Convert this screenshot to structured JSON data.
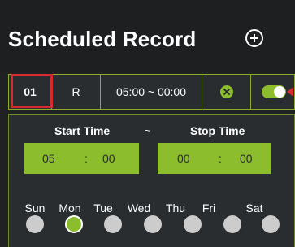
{
  "header": {
    "title": "Scheduled Record",
    "add_icon": "plus-circle-icon"
  },
  "schedule": {
    "id": "01",
    "mode": "R",
    "time_range": "05:00 ~ 00:00",
    "delete_icon": "close-circle-icon",
    "enabled": true
  },
  "detail": {
    "start_label": "Start Time",
    "separator": "~",
    "stop_label": "Stop Time",
    "start_hour": "05",
    "start_minute": "00",
    "stop_hour": "00",
    "stop_minute": "00",
    "colon": ":"
  },
  "days": [
    {
      "label": "Sun",
      "selected": false
    },
    {
      "label": "Mon",
      "selected": true
    },
    {
      "label": "Tue",
      "selected": false
    },
    {
      "label": "Wed",
      "selected": false
    },
    {
      "label": "Thu",
      "selected": false
    },
    {
      "label": "Fri",
      "selected": false
    },
    {
      "label": "Sat",
      "selected": false
    }
  ],
  "colors": {
    "accent_green": "#8cbd2c",
    "highlight_red": "#d42a30",
    "background": "#2a2d2f"
  }
}
